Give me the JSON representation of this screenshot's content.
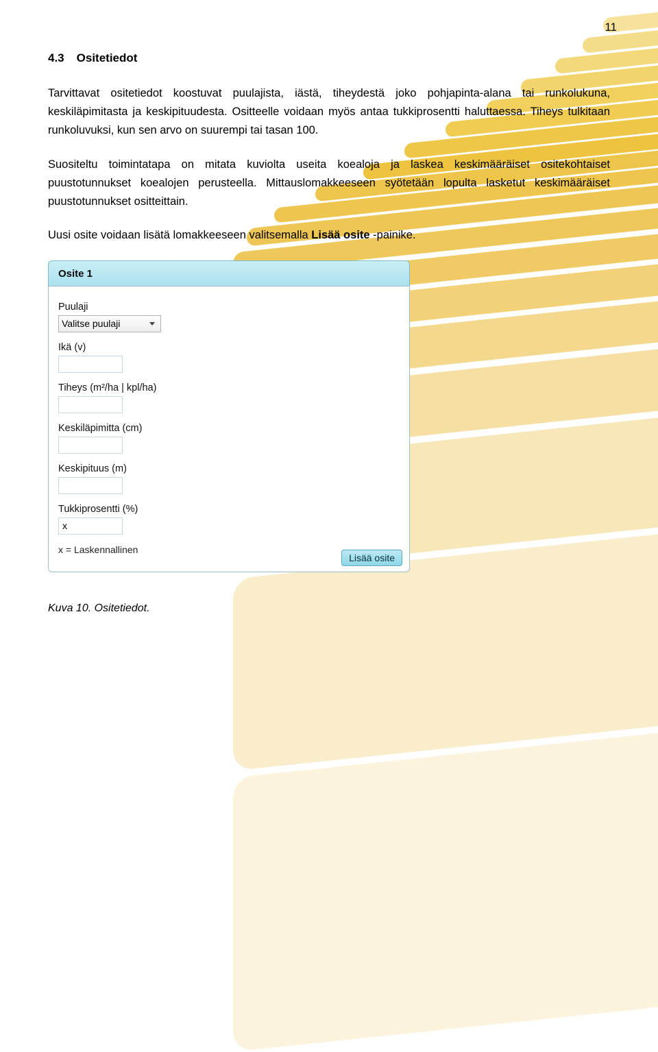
{
  "page_number": "11",
  "heading": {
    "num": "4.3",
    "title": "Ositetiedot"
  },
  "paragraphs": {
    "p1": "Tarvittavat ositetiedot koostuvat puulajista, iästä, tiheydestä joko pohjapinta-alana tai runkolukuna, keskiläpimitasta ja keskipituudesta. Ositteelle voidaan myös antaa tukkiprosentti haluttaessa. Tiheys tulkitaan runkoluvuksi, kun sen arvo on suurempi tai tasan 100.",
    "p2": "Suositeltu toimintatapa on mitata kuviolta useita koealoja ja laskea keskimääräiset ositekohtaiset puustotunnukset koealojen perusteella. Mittauslomakkeeseen syötetään lopulta lasketut keskimääräiset puustotunnukset ositteittain.",
    "p3_pre": "Uusi osite voidaan lisätä lomakkeeseen valitsemalla ",
    "p3_bold": "Lisää osite",
    "p3_post": " -painike."
  },
  "form": {
    "tab_label": "Osite 1",
    "fields": {
      "puulaji_label": "Puulaji",
      "puulaji_select": "Valitse puulaji",
      "ika_label": "Ikä (v)",
      "tiheys_label": "Tiheys (m²/ha | kpl/ha)",
      "keskilapimitta_label": "Keskiläpimitta (cm)",
      "keskipituus_label": "Keskipituus (m)",
      "tukki_label": "Tukkiprosentti (%)",
      "tukki_value": "x",
      "note": "x = Laskennallinen"
    },
    "add_button": "Lisää osite"
  },
  "caption": "Kuva 10. Ositetiedot."
}
